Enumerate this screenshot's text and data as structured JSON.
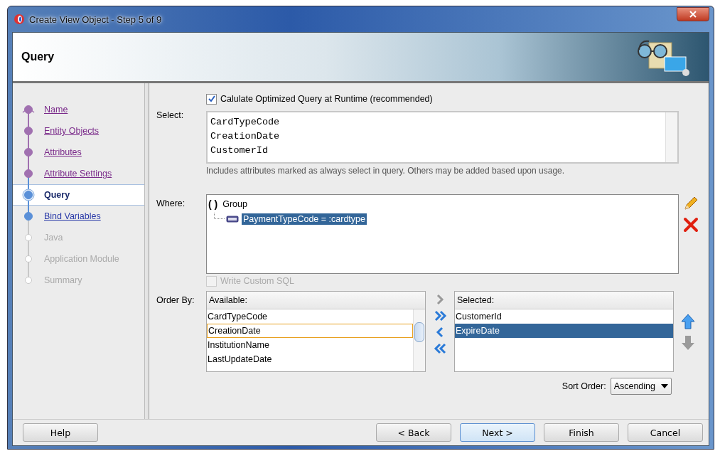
{
  "window": {
    "title": "Create View Object - Step 5 of 9"
  },
  "header": {
    "title": "Query"
  },
  "steps": [
    {
      "label": "Name",
      "visited": true,
      "disabled": false,
      "selected": false
    },
    {
      "label": "Entity Objects",
      "visited": true,
      "disabled": false,
      "selected": false
    },
    {
      "label": "Attributes",
      "visited": true,
      "disabled": false,
      "selected": false
    },
    {
      "label": "Attribute Settings",
      "visited": true,
      "disabled": false,
      "selected": false
    },
    {
      "label": "Query",
      "visited": false,
      "disabled": false,
      "selected": true
    },
    {
      "label": "Bind Variables",
      "visited": false,
      "disabled": false,
      "selected": false
    },
    {
      "label": "Java",
      "visited": false,
      "disabled": true,
      "selected": false
    },
    {
      "label": "Application Module",
      "visited": false,
      "disabled": true,
      "selected": false
    },
    {
      "label": "Summary",
      "visited": false,
      "disabled": true,
      "selected": false
    }
  ],
  "optimize": {
    "label": "Calulate Optimized Query at Runtime (recommended)",
    "checked": true
  },
  "select": {
    "label": "Select:",
    "items": [
      "CardTypeCode",
      "CreationDate",
      "CustomerId"
    ],
    "hint": "Includes attributes marked as always select in query.  Others may be added based upon usage."
  },
  "where": {
    "label": "Where:",
    "group_icon": "( )",
    "group": "Group",
    "children": [
      {
        "text": "PaymentTypeCode = :cardtype",
        "selected": true
      }
    ]
  },
  "custom_sql": {
    "label": "Write Custom SQL",
    "checked": false,
    "disabled": true
  },
  "order_by": {
    "label": "Order By:",
    "available": {
      "header": "Available:",
      "items": [
        {
          "text": "CardTypeCode",
          "selected": false
        },
        {
          "text": "CreationDate",
          "selected": true
        },
        {
          "text": "InstitutionName",
          "selected": false
        },
        {
          "text": "LastUpdateDate",
          "selected": false
        }
      ]
    },
    "selected": {
      "header": "Selected:",
      "items": [
        {
          "text": "CustomerId",
          "selected": false
        },
        {
          "text": "ExpireDate",
          "selected": true
        }
      ]
    },
    "sort_label": "Sort Order:",
    "sort_value": "Ascending"
  },
  "buttons": [
    {
      "label": "Help",
      "kind": "left"
    },
    {
      "label": "< Back",
      "kind": "right"
    },
    {
      "label": "Next >",
      "kind": "default"
    },
    {
      "label": "Finish",
      "kind": "right"
    },
    {
      "label": "Cancel",
      "kind": "right"
    }
  ]
}
